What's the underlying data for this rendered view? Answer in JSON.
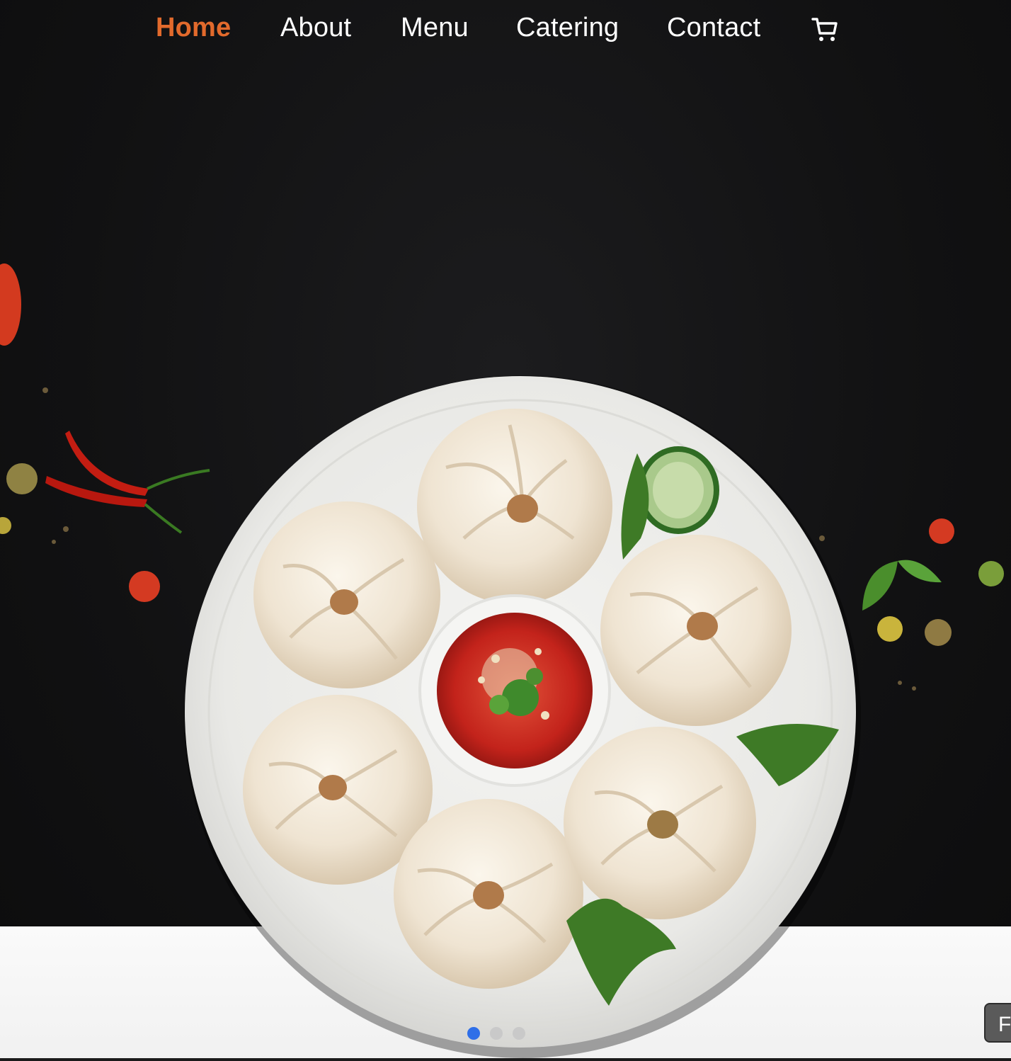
{
  "nav": {
    "items": [
      {
        "label": "Home",
        "active": true
      },
      {
        "label": "About",
        "active": false
      },
      {
        "label": "Menu",
        "active": false
      },
      {
        "label": "Catering",
        "active": false
      },
      {
        "label": "Contact",
        "active": false
      }
    ],
    "cart_icon": "shopping-cart-icon"
  },
  "hero": {
    "image": "plate of steamed dumplings with chili dipping sauce",
    "carousel": {
      "slides": 3,
      "active_index": 0
    }
  },
  "side_button": {
    "label": "F"
  },
  "colors": {
    "accent": "#e26a2c",
    "background": "#141414",
    "nav_text": "#ffffff",
    "dot_active": "#2f6fe8",
    "dot_inactive": "#c9c9c9"
  }
}
